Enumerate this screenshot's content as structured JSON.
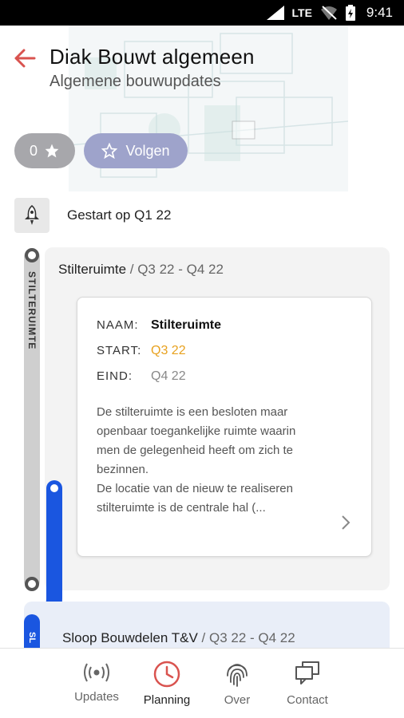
{
  "status_bar": {
    "network": "LTE",
    "time": "9:41"
  },
  "header": {
    "title": "Diak Bouwt algemeen",
    "subtitle": "Algemene bouwupdates",
    "stars_count": "0",
    "follow_label": "Volgen"
  },
  "started": {
    "text": "Gestart op Q1 22"
  },
  "timeline": {
    "current": {
      "vertical_label": "STILTERUIMTE",
      "title_name": "Stilteruimte",
      "title_sep": " / ",
      "title_period": "Q3 22 - Q4 22",
      "card": {
        "name_key": "NAAM:",
        "name_value": "Stilteruimte",
        "start_key": "START:",
        "start_value": "Q3 22",
        "end_key": "EIND:",
        "end_value": "Q4 22",
        "description": "De stilteruimte is een besloten maar openbaar toegankelijke ruimte waarin men de gelegenheid heeft om zich te bezinnen.\nDe locatie van de nieuw te realiseren stilteruimte is de centrale hal (..."
      }
    },
    "next": {
      "vertical_label": "SL",
      "title_name": "Sloop Bouwdelen T&V",
      "title_sep": " / ",
      "title_period": "Q3 22 - Q4 22"
    }
  },
  "bottom_nav": {
    "items": [
      {
        "label": "Updates",
        "icon": "broadcast-icon"
      },
      {
        "label": "Planning",
        "icon": "clock-icon",
        "active": true
      },
      {
        "label": "Over",
        "icon": "fingerprint-icon"
      },
      {
        "label": "Contact",
        "icon": "chat-icon"
      }
    ]
  },
  "colors": {
    "accent_red": "#d9534f",
    "timeline_blue": "#1a56e0",
    "start_orange": "#e8a11e",
    "follow_button": "#9ea3cb"
  }
}
